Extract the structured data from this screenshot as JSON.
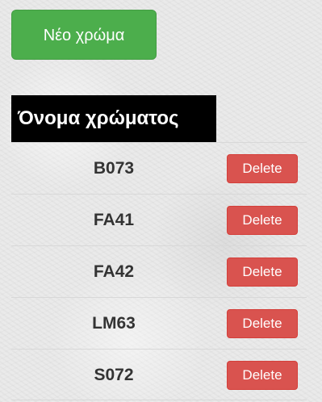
{
  "toolbar": {
    "new_color_label": "Νέο χρώμα"
  },
  "table": {
    "header": "Όνομα χρώματος",
    "delete_label": "Delete",
    "rows": [
      {
        "code": "B073"
      },
      {
        "code": "FA41"
      },
      {
        "code": "FA42"
      },
      {
        "code": "LM63"
      },
      {
        "code": "S072"
      }
    ]
  },
  "colors": {
    "success": "#4cae4c",
    "danger": "#d9534f",
    "header_bg": "#000000"
  }
}
